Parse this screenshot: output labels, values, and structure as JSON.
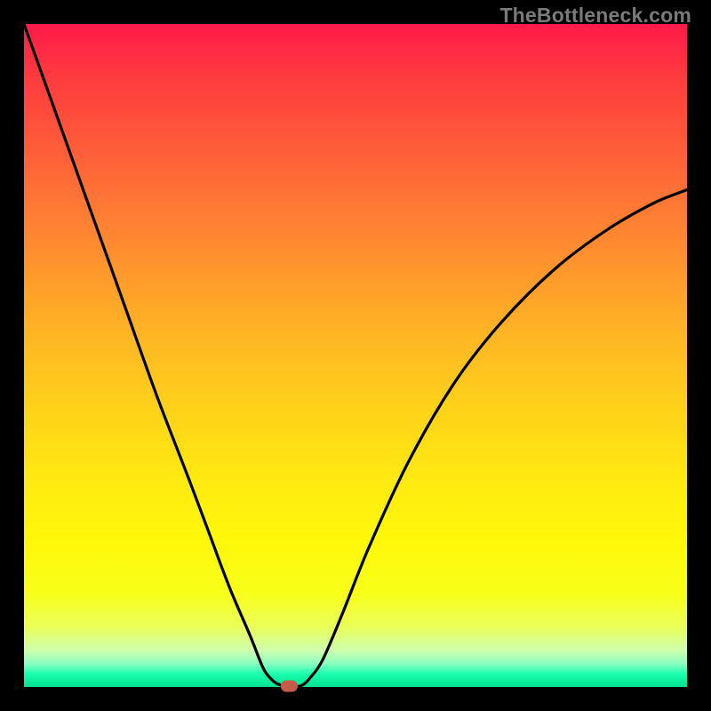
{
  "watermark": "TheBottleneck.com",
  "chart_data": {
    "type": "line",
    "title": "",
    "xlabel": "",
    "ylabel": "",
    "xlim": [
      0,
      100
    ],
    "ylim": [
      0,
      100
    ],
    "grid": false,
    "legend": false,
    "series": [
      {
        "name": "bottleneck-curve",
        "x": [
          0,
          5,
          10,
          15,
          20,
          25,
          28,
          31,
          34,
          36,
          37,
          38,
          39,
          40,
          41,
          42,
          43,
          45,
          48,
          52,
          58,
          65,
          72,
          80,
          88,
          95,
          100
        ],
        "values": [
          100,
          86,
          72,
          58,
          44,
          31,
          23,
          15,
          8,
          3,
          1.5,
          0.6,
          0.2,
          0,
          0,
          0.3,
          1.2,
          4,
          11,
          21,
          34,
          46,
          55,
          63,
          69,
          73,
          75
        ]
      }
    ],
    "annotations": [
      {
        "name": "optimal-marker",
        "x": 40,
        "y": 0
      }
    ],
    "background_gradient": {
      "type": "vertical",
      "stops": [
        {
          "pos": 0.0,
          "color": "#ff1a4a"
        },
        {
          "pos": 0.5,
          "color": "#ffd21a"
        },
        {
          "pos": 0.95,
          "color": "#d0ffb0"
        },
        {
          "pos": 1.0,
          "color": "#00e090"
        }
      ]
    },
    "border_color": "#000000"
  }
}
